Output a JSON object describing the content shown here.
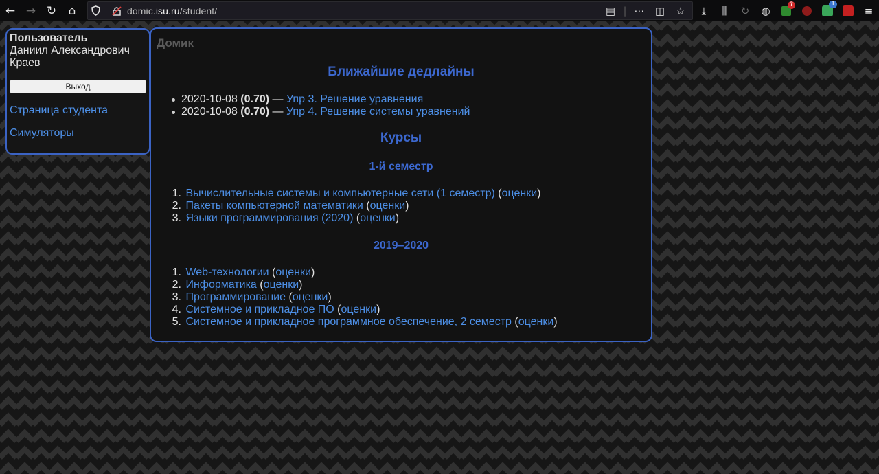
{
  "browser": {
    "url_prefix": "domic.",
    "url_domain": "isu.ru",
    "url_path": "/student/",
    "badges": {
      "ext1": "?",
      "ext2": "1"
    }
  },
  "sidebar": {
    "heading": "Пользователь",
    "name_line1": "Даниил Александрович",
    "name_line2": "Краев",
    "logout_label": "Выход",
    "links": [
      {
        "label": "Страница студента"
      },
      {
        "label": "Симуляторы"
      }
    ]
  },
  "main": {
    "breadcrumb": "Домик",
    "deadlines_title": "Ближайшие дедлайны",
    "deadlines": [
      {
        "date": "2020-10-08",
        "weight": "(0.70)",
        "dash": " — ",
        "title": "Упр 3. Решение уравнения"
      },
      {
        "date": "2020-10-08",
        "weight": "(0.70)",
        "dash": " — ",
        "title": "Упр 4. Решение системы уравнений"
      }
    ],
    "courses_title": "Курсы",
    "grades_label": "оценки",
    "semesters": [
      {
        "title": "1-й семестр",
        "courses": [
          {
            "num": "1.",
            "name": "Вычислительные системы и компьютерные сети (1 семестр)"
          },
          {
            "num": "2.",
            "name": "Пакеты компьютерной математики"
          },
          {
            "num": "3.",
            "name": "Языки программирования (2020)"
          }
        ]
      },
      {
        "title": "2019–2020",
        "courses": [
          {
            "num": "1.",
            "name": "Web-технологии"
          },
          {
            "num": "2.",
            "name": "Информатика"
          },
          {
            "num": "3.",
            "name": "Программирование"
          },
          {
            "num": "4.",
            "name": "Системное и прикладное ПО"
          },
          {
            "num": "5.",
            "name": "Системное и прикладное программное обеспечение, 2 семестр"
          }
        ]
      }
    ]
  },
  "colors": {
    "accent": "#3c68cf",
    "link": "#4d8fe6",
    "border": "#3b63c4"
  }
}
